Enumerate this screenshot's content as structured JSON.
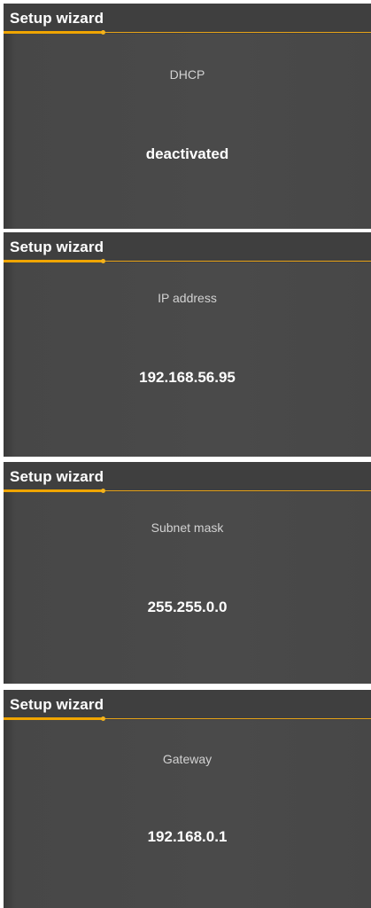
{
  "accent_color": "#f0a500",
  "screens": [
    {
      "title": "Setup wizard",
      "label": "DHCP",
      "value": "deactivated",
      "progress": 0.27
    },
    {
      "title": "Setup wizard",
      "label": "IP address",
      "value": "192.168.56.95",
      "progress": 0.27
    },
    {
      "title": "Setup wizard",
      "label": "Subnet mask",
      "value": "255.255.0.0",
      "progress": 0.27
    },
    {
      "title": "Setup wizard",
      "label": "Gateway",
      "value": "192.168.0.1",
      "progress": 0.27
    }
  ]
}
